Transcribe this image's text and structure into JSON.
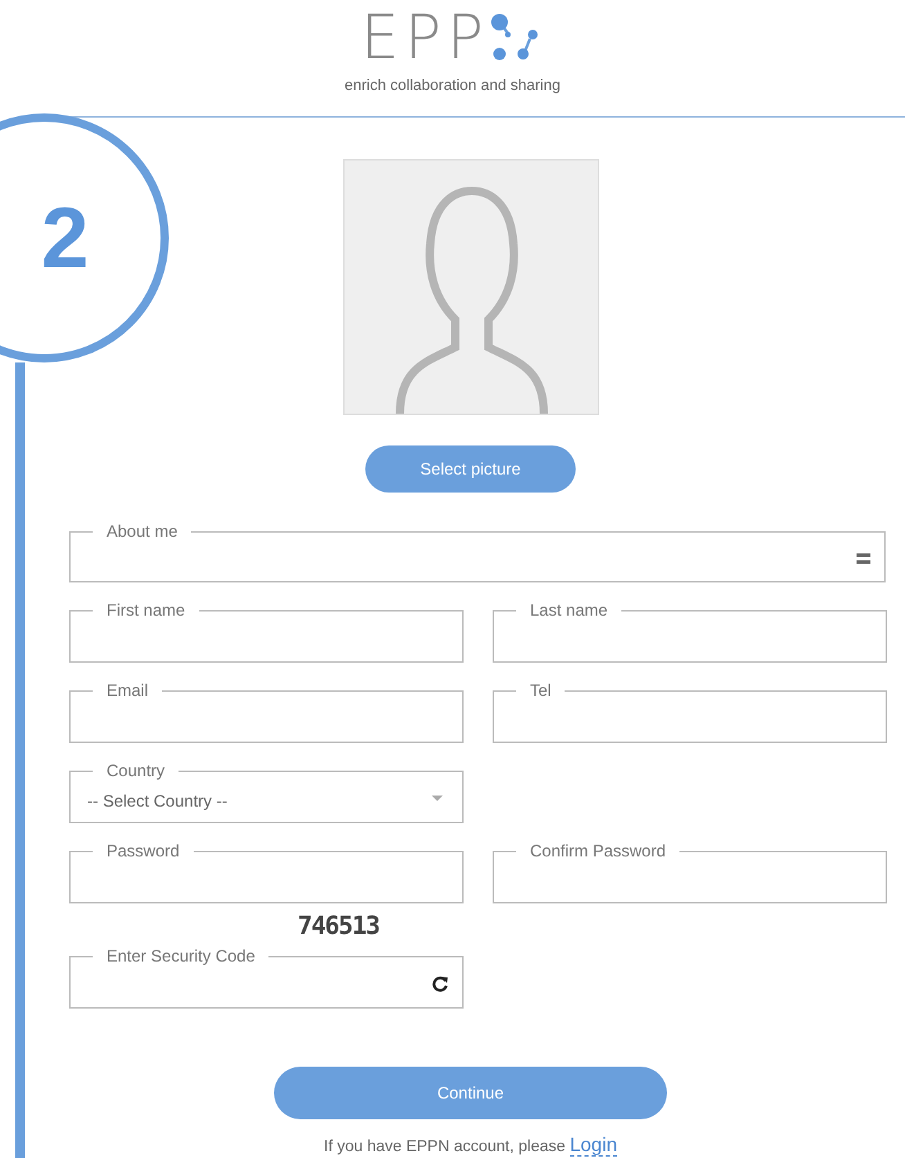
{
  "logo": {
    "wordmark": "EPP",
    "tagline": "enrich collaboration and sharing"
  },
  "step": {
    "number": "2"
  },
  "picture_button": "Select picture",
  "form_rows": [
    [
      {
        "kind": "textarea",
        "label": "About me"
      }
    ],
    [
      {
        "kind": "text",
        "label": "First name"
      },
      {
        "kind": "text",
        "label": "Last name"
      }
    ],
    [
      {
        "kind": "text",
        "label": "Email"
      },
      {
        "kind": "text",
        "label": "Tel"
      }
    ],
    [
      {
        "kind": "select",
        "label": "Country",
        "value": "-- Select Country --"
      }
    ],
    [
      {
        "kind": "text",
        "label": "Password"
      },
      {
        "kind": "text",
        "label": "Confirm Password"
      }
    ],
    [
      {
        "kind": "captcha",
        "label": "Enter Security Code",
        "code": "746513"
      }
    ]
  ],
  "submit_button": "Continue",
  "footer": {
    "text": "If you have EPPN account, please",
    "link": "Login"
  }
}
